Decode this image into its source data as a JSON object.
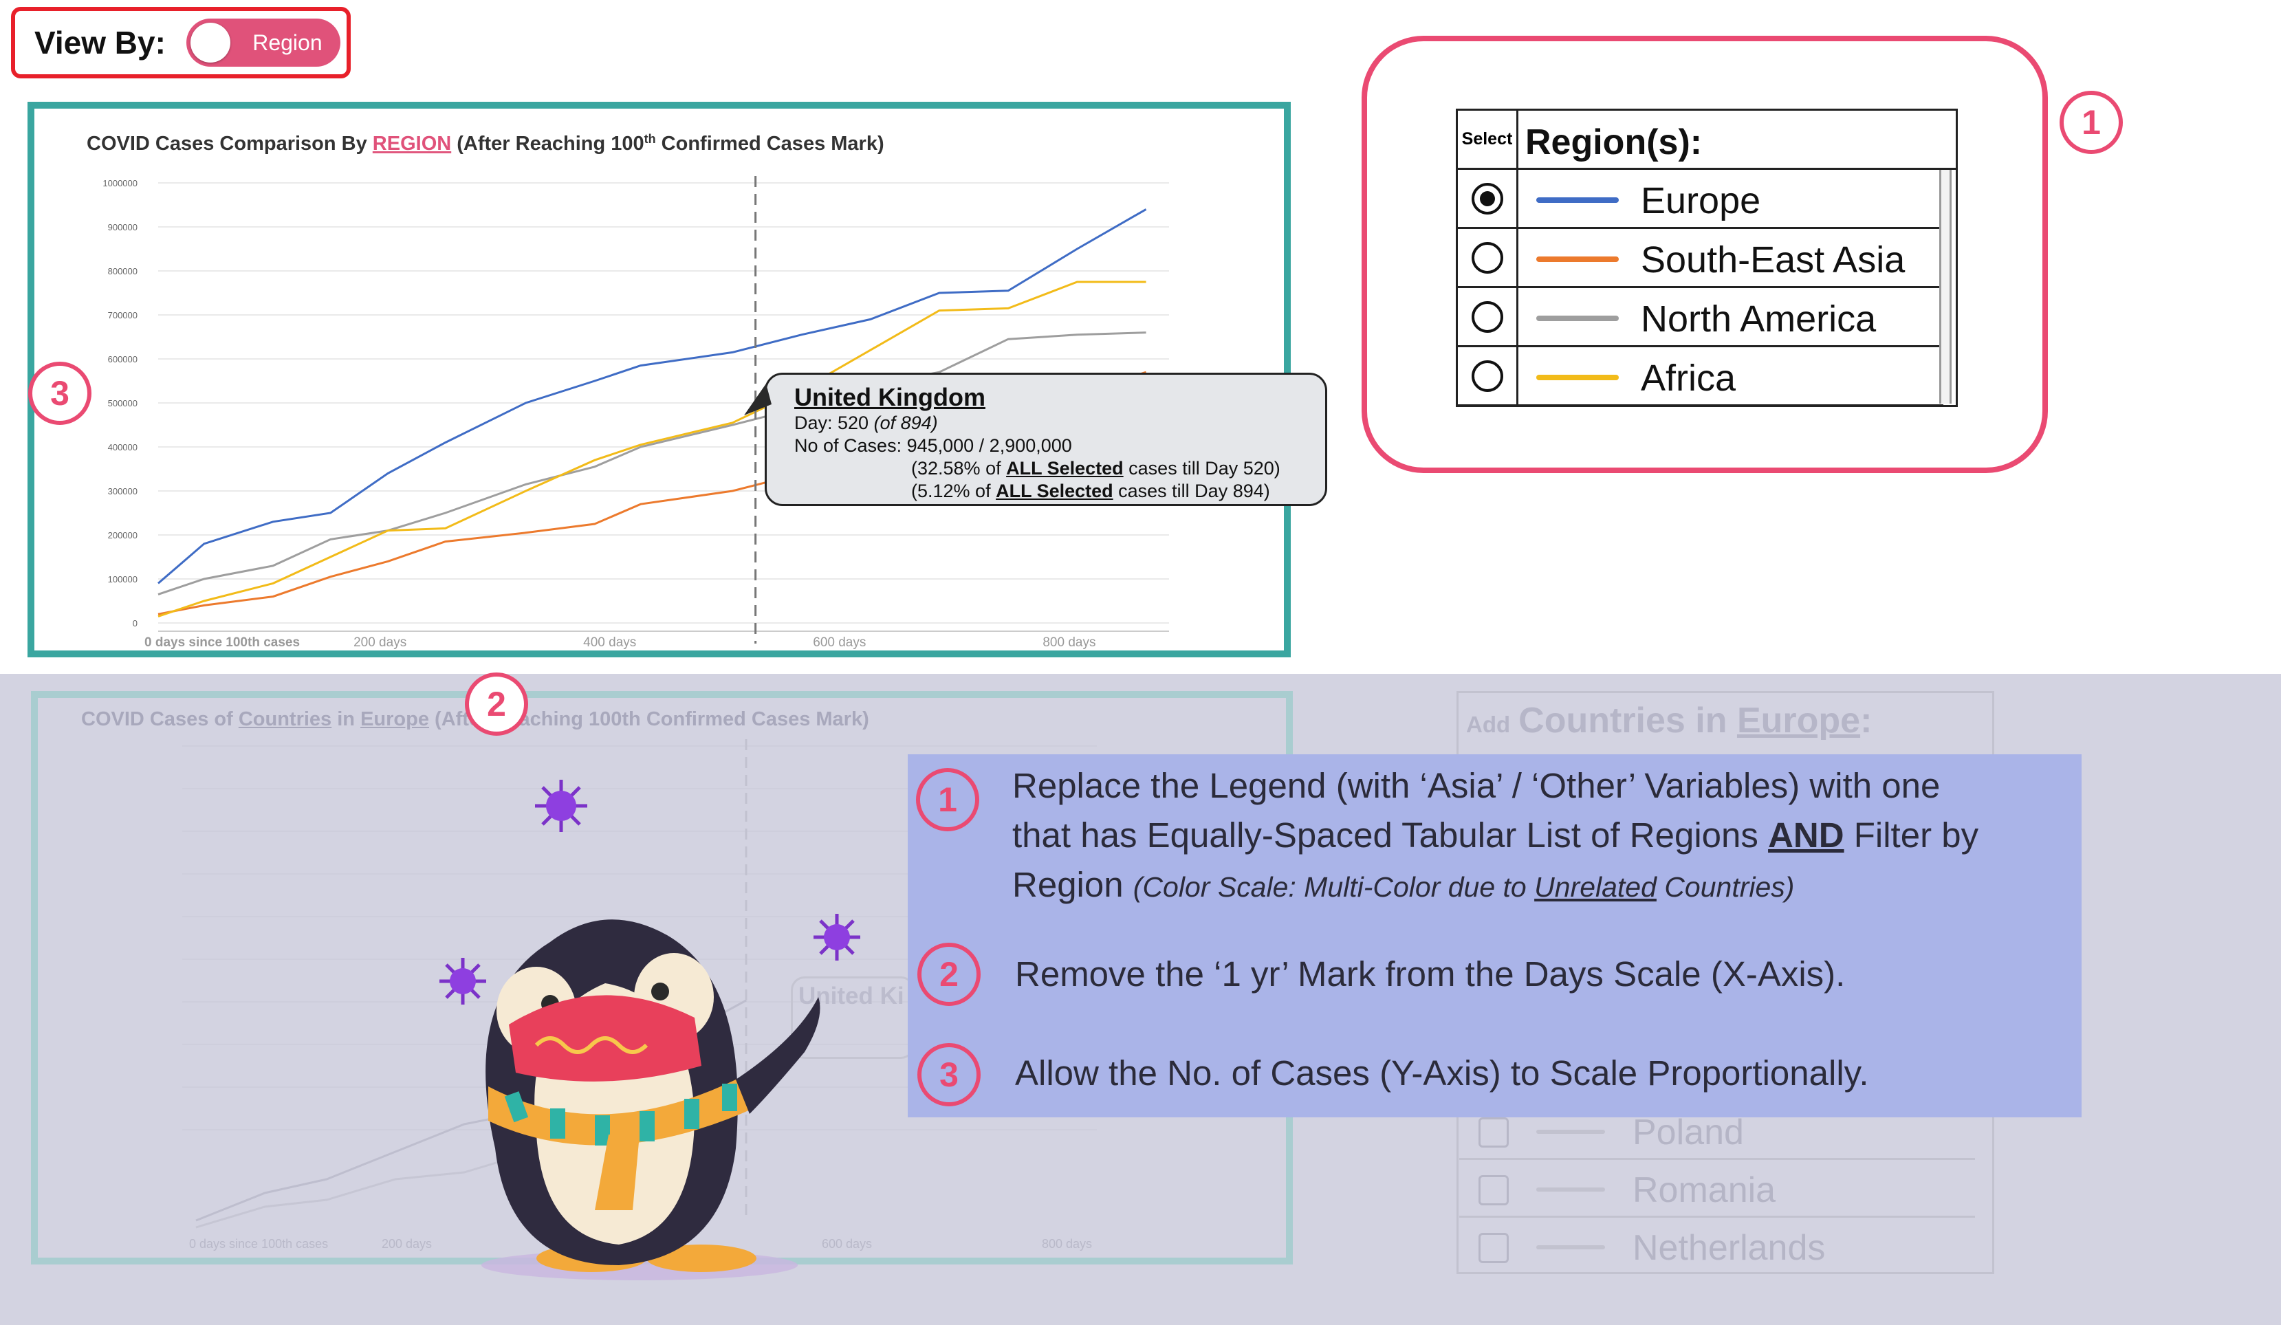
{
  "view_by": {
    "label": "View By:",
    "toggle_value": "Region"
  },
  "chart_title": {
    "prefix": "COVID Cases Comparison By ",
    "link": "REGION",
    "suffix_a": " (After Reaching  100",
    "superscript": "th",
    "suffix_b": " Confirmed Cases Mark)"
  },
  "chart_data": {
    "type": "line",
    "x": [
      0,
      40,
      100,
      150,
      200,
      250,
      320,
      380,
      420,
      500,
      560,
      620,
      680,
      740,
      800,
      860
    ],
    "x_tick_labels": [
      "0 days since 100th cases",
      "200 days",
      "400 days",
      "600 days",
      "800 days"
    ],
    "y_tick_labels": [
      "0",
      "100000",
      "200000",
      "300000",
      "400000",
      "500000",
      "600000",
      "700000",
      "800000",
      "900000",
      "1000000"
    ],
    "ylim": [
      0,
      1000000
    ],
    "xlim": [
      0,
      880
    ],
    "marker_day": 520,
    "series": [
      {
        "name": "Europe",
        "color": "#3f6cc5",
        "values": [
          90000,
          180000,
          230000,
          250000,
          340000,
          410000,
          500000,
          550000,
          585000,
          615000,
          655000,
          690000,
          750000,
          755000,
          850000,
          940000
        ]
      },
      {
        "name": "South-East Asia",
        "color": "#ec7a2d",
        "values": [
          20000,
          40000,
          60000,
          105000,
          140000,
          185000,
          205000,
          225000,
          270000,
          300000,
          340000,
          380000,
          420000,
          460000,
          520000,
          570000
        ]
      },
      {
        "name": "North America",
        "color": "#9e9e9e",
        "values": [
          65000,
          100000,
          130000,
          190000,
          210000,
          250000,
          315000,
          355000,
          400000,
          450000,
          490000,
          540000,
          570000,
          645000,
          655000,
          660000
        ]
      },
      {
        "name": "Africa",
        "color": "#f2bb19",
        "values": [
          15000,
          50000,
          90000,
          150000,
          210000,
          215000,
          300000,
          370000,
          405000,
          455000,
          530000,
          620000,
          710000,
          715000,
          775000,
          775000
        ]
      }
    ]
  },
  "tooltip": {
    "country": "United Kingdom",
    "day_label": "Day: 520 ",
    "day_of": "(of 894)",
    "cases_label": "No of Cases:  945,000 / 2,900,000",
    "pct1_a": "(32.58% of ",
    "pct1_b": "ALL Selected",
    "pct1_c": " cases till Day 520)",
    "pct2_a": "(5.12% of ",
    "pct2_b": "ALL Selected",
    "pct2_c": " cases till Day 894)"
  },
  "markers": {
    "one": "1",
    "two": "2",
    "three": "3"
  },
  "legend": {
    "select_label": "Select",
    "title": "Region(s):",
    "items": [
      {
        "name": "Europe",
        "color": "#3f6cc5",
        "selected": true
      },
      {
        "name": "South-East Asia",
        "color": "#ec7a2d",
        "selected": false
      },
      {
        "name": "North America",
        "color": "#9e9e9e",
        "selected": false
      },
      {
        "name": "Africa",
        "color": "#f2bb19",
        "selected": false
      }
    ]
  },
  "lower": {
    "title_a": "COVID Cases of ",
    "title_countries": "Countries",
    "title_b": " in ",
    "title_europe": "Europe",
    "title_c": " (After Reaching  100th Confirmed Cases Mark)",
    "legend_add": "Add",
    "legend_title_a": "Countries in ",
    "legend_title_b": "Europe",
    "legend_title_c": ":",
    "countries": [
      "Poland",
      "Romania",
      "Netherlands"
    ],
    "uk_label": "United Ki",
    "x_labels": [
      "0 days since 100th cases",
      "200 days",
      "600 days",
      "800 days"
    ]
  },
  "notes": {
    "n1_line1": "Replace the Legend (with ‘Asia’ / ‘Other’ Variables) with one",
    "n1_line2a": "that has Equally-Spaced Tabular List of Regions ",
    "n1_line2b": "AND",
    "n1_line2c": " Filter by",
    "n1_line3a": "Region ",
    "n1_line3b": "(Color Scale: Multi-Color due to ",
    "n1_line3c": "Unrelated",
    "n1_line3d": " Countries)",
    "n2": "Remove the ‘1 yr’ Mark from the Days Scale (X-Axis).",
    "n3": "Allow the No. of Cases (Y-Axis) to Scale Proportionally."
  }
}
